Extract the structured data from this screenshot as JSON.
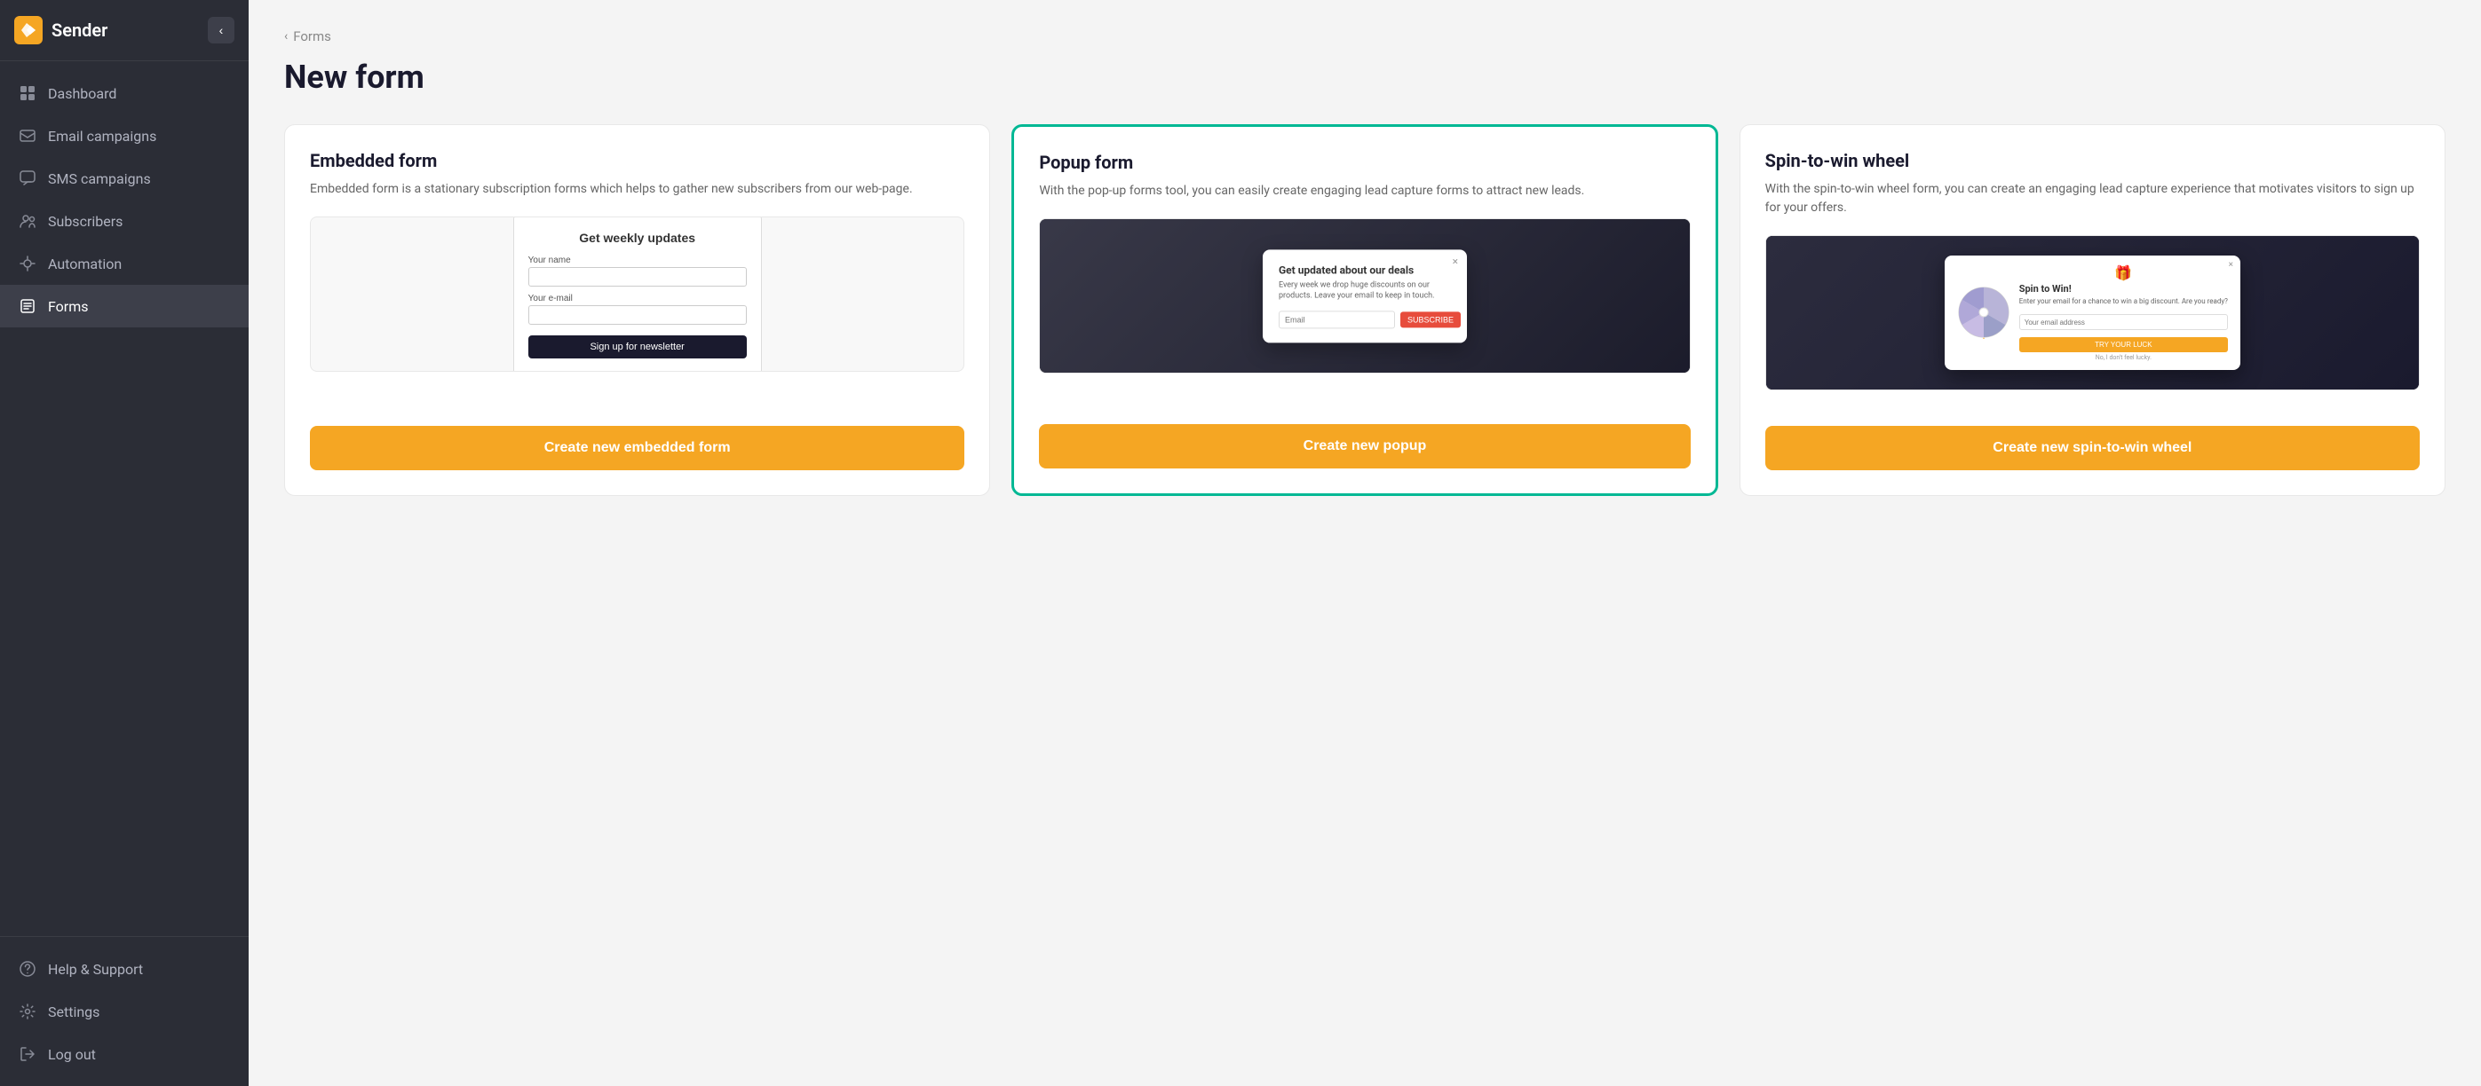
{
  "sidebar": {
    "brand": "Sender",
    "collapse_btn": "‹",
    "nav_items": [
      {
        "id": "dashboard",
        "label": "Dashboard",
        "icon": "grid-icon",
        "active": false
      },
      {
        "id": "email-campaigns",
        "label": "Email campaigns",
        "icon": "email-icon",
        "active": false
      },
      {
        "id": "sms-campaigns",
        "label": "SMS campaigns",
        "icon": "sms-icon",
        "active": false
      },
      {
        "id": "subscribers",
        "label": "Subscribers",
        "icon": "subscribers-icon",
        "active": false
      },
      {
        "id": "automation",
        "label": "Automation",
        "icon": "automation-icon",
        "active": false
      },
      {
        "id": "forms",
        "label": "Forms",
        "icon": "forms-icon",
        "active": true
      }
    ],
    "bottom_items": [
      {
        "id": "help",
        "label": "Help & Support",
        "icon": "help-icon"
      },
      {
        "id": "settings",
        "label": "Settings",
        "icon": "settings-icon"
      },
      {
        "id": "logout",
        "label": "Log out",
        "icon": "logout-icon"
      }
    ]
  },
  "breadcrumb": {
    "chevron": "‹",
    "link_label": "Forms"
  },
  "page": {
    "title": "New form"
  },
  "cards": [
    {
      "id": "embedded",
      "title": "Embedded form",
      "desc": "Embedded form is a stationary subscription forms which helps to gather new subscribers from our web-page.",
      "highlighted": false,
      "btn_label": "Create new embedded form",
      "preview": {
        "type": "embedded",
        "form_title": "Get weekly updates",
        "name_label": "Your name",
        "email_label": "Your e-mail",
        "btn_label": "Sign up for newsletter"
      }
    },
    {
      "id": "popup",
      "title": "Popup form",
      "desc": "With the pop-up forms tool, you can easily create engaging lead capture forms to attract new leads.",
      "highlighted": true,
      "btn_label": "Create new popup",
      "preview": {
        "type": "popup",
        "modal_title": "Get updated about our deals",
        "modal_text": "Every week we drop huge discounts on our products. Leave your email to keep in touch.",
        "email_placeholder": "Email",
        "btn_label": "SUBSCRIBE"
      }
    },
    {
      "id": "spin",
      "title": "Spin-to-win wheel",
      "desc": "With the spin-to-win wheel form, you can create an engaging lead capture experience that motivates visitors to sign up for your offers.",
      "highlighted": false,
      "btn_label": "Create new spin-to-win wheel",
      "preview": {
        "type": "spin",
        "modal_title": "Spin to Win!",
        "modal_text": "Enter your email for a chance to win a big discount. Are you ready?",
        "email_placeholder": "Your email address",
        "btn_label": "TRY YOUR LUCK",
        "no_label": "No, I don't feel lucky."
      }
    }
  ]
}
